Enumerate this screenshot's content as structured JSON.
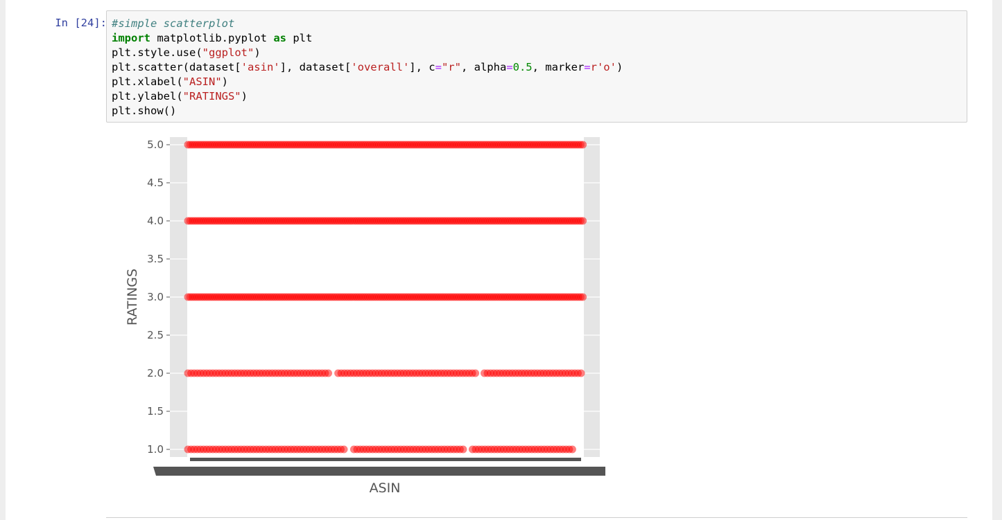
{
  "cell": {
    "prompt": "In [24]:",
    "code_lines": [
      [
        {
          "t": "#simple scatterplot",
          "c": "cm-comment"
        }
      ],
      [
        {
          "t": "import",
          "c": "cm-keyword"
        },
        {
          "t": " matplotlib.pyplot "
        },
        {
          "t": "as",
          "c": "cm-keyword"
        },
        {
          "t": " plt"
        }
      ],
      [
        {
          "t": "plt.style.use("
        },
        {
          "t": "\"ggplot\"",
          "c": "cm-string"
        },
        {
          "t": ")"
        }
      ],
      [
        {
          "t": "plt.scatter(dataset["
        },
        {
          "t": "'asin'",
          "c": "cm-string"
        },
        {
          "t": "], dataset["
        },
        {
          "t": "'overall'",
          "c": "cm-string"
        },
        {
          "t": "], c"
        },
        {
          "t": "=",
          "c": "cm-operator"
        },
        {
          "t": "\"r\"",
          "c": "cm-string"
        },
        {
          "t": ", alpha"
        },
        {
          "t": "=",
          "c": "cm-operator"
        },
        {
          "t": "0.5",
          "c": "cm-number"
        },
        {
          "t": ", marker"
        },
        {
          "t": "=",
          "c": "cm-operator"
        },
        {
          "t": "r'o'",
          "c": "cm-string"
        },
        {
          "t": ")"
        }
      ],
      [
        {
          "t": "plt.xlabel("
        },
        {
          "t": "\"ASIN\"",
          "c": "cm-string"
        },
        {
          "t": ")"
        }
      ],
      [
        {
          "t": "plt.ylabel("
        },
        {
          "t": "\"RATINGS\"",
          "c": "cm-string"
        },
        {
          "t": ")"
        }
      ],
      [
        {
          "t": "plt.show()"
        }
      ]
    ]
  },
  "chart_data": {
    "type": "scatter",
    "title": "",
    "xlabel": "ASIN",
    "ylabel": "RATINGS",
    "ylim": [
      0.9,
      5.1
    ],
    "yticks": [
      "1.0",
      "1.5",
      "2.0",
      "2.5",
      "3.0",
      "3.5",
      "4.0",
      "4.5",
      "5.0"
    ],
    "style": "ggplot",
    "marker_color": "#ff0000",
    "alpha": 0.5,
    "grid": true,
    "x_tick_labels_note": "overlapping ASIN labels, unreadable",
    "series": [
      {
        "y": 5.0,
        "coverage": [
          [
            0.0,
            1.0
          ]
        ]
      },
      {
        "y": 4.0,
        "coverage": [
          [
            0.0,
            1.0
          ]
        ]
      },
      {
        "y": 3.0,
        "coverage": [
          [
            0.0,
            1.0
          ]
        ]
      },
      {
        "y": 2.0,
        "coverage": [
          [
            0.0,
            0.36
          ],
          [
            0.38,
            0.73
          ],
          [
            0.75,
            1.0
          ]
        ]
      },
      {
        "y": 1.0,
        "coverage": [
          [
            0.0,
            0.4
          ],
          [
            0.42,
            0.7
          ],
          [
            0.72,
            0.98
          ]
        ]
      }
    ]
  }
}
